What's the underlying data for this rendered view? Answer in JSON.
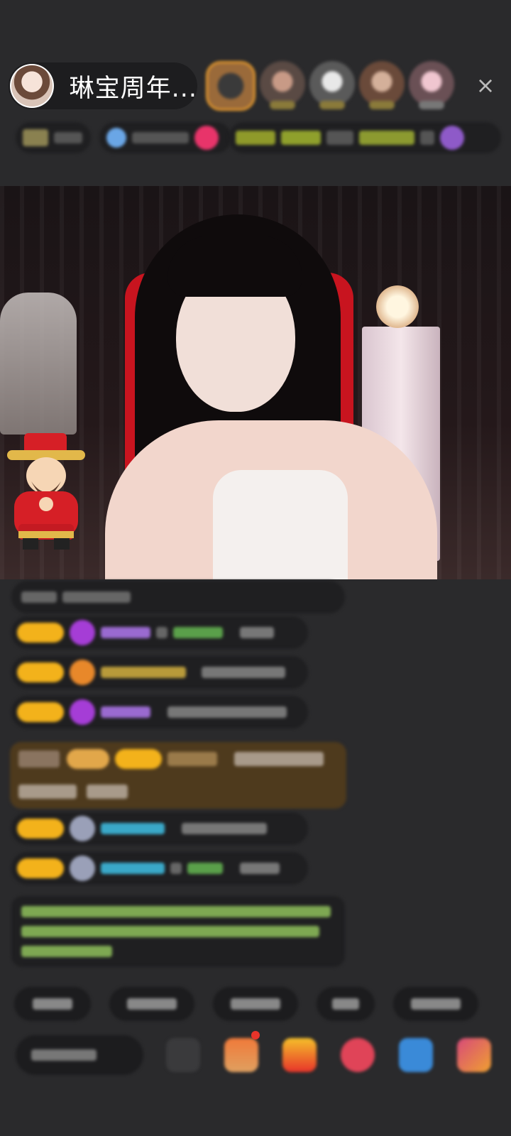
{
  "header": {
    "anchor_name": "琳宝周年...",
    "close_icon": "×"
  },
  "colors": {
    "background": "#2a2a2c",
    "level_badge": "#f3b21b",
    "chip_bg": "#1f1f21",
    "gift_banner": "#4e3a1d",
    "system_text": "#9bcf6a",
    "chair_red": "#c8141f"
  },
  "icons": {
    "close": "close-icon",
    "god_of_wealth": "god-of-wealth-icon",
    "gift": "gift-icon",
    "emoji": "emoji-icon"
  }
}
